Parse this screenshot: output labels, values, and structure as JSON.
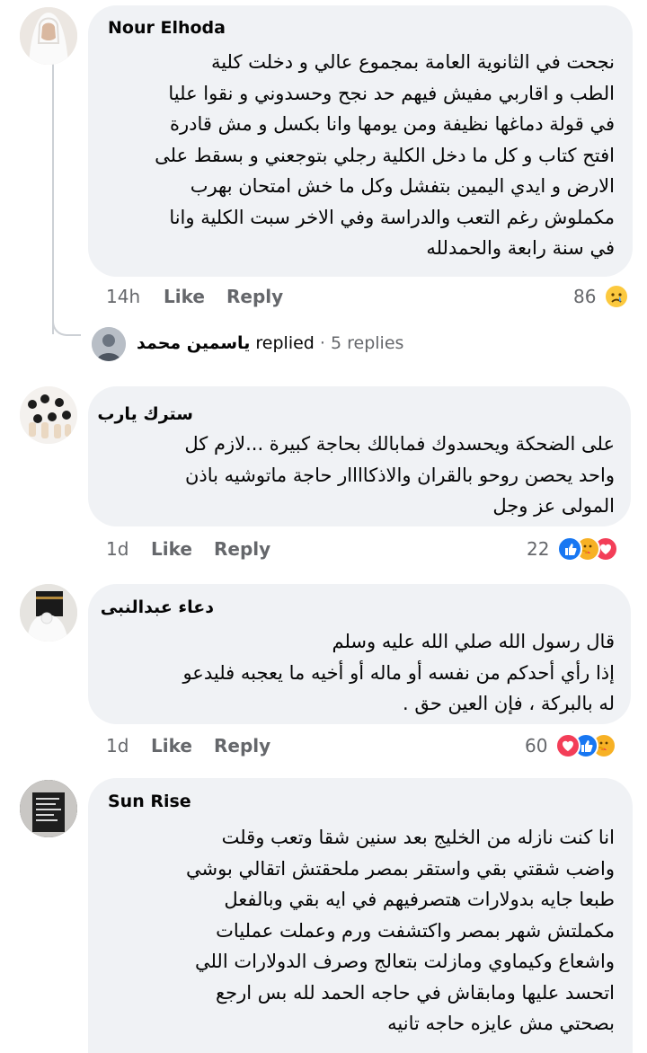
{
  "comments": [
    {
      "author": "Nour Elhoda",
      "text": "نجحت في الثانوية العامة بمجموع عالي و دخلت كلية\nالطب و اقاربي مفيش فيهم حد نجح وحسدوني و نقوا عليا\nفي قولة دماغها نظيفة ومن يومها وانا بكسل و مش قادرة\nافتح كتاب و كل ما دخل الكلية رجلي بتوجعني و بسقط على\nالارض و ايدي اليمين بتفشل وكل ما خش امتحان بهرب\nمكملوش رغم التعب والدراسة وفي الاخر سبت الكلية وانا\nفي سنة رابعة والحمدلله",
      "time": "14h",
      "like": "Like",
      "reply": "Reply",
      "count": "86",
      "reactions": [
        "sad"
      ]
    },
    {
      "author": "سترك يارب",
      "text": "على الضحكة ويحسدوك فمابالك بحاجة كبيرة ...لازم كل\nواحد يحصن روحو بالقران والاذكاااار حاجة ماتوشيه باذن\nالمولى عز وجل",
      "time": "1d",
      "like": "Like",
      "reply": "Reply",
      "count": "22",
      "reactions": [
        "like",
        "care",
        "love"
      ]
    },
    {
      "author": "دعاء عبدالنبى",
      "text": "قال رسول الله صلي الله عليه وسلم\nإذا رأي أحدكم من نفسه أو ماله أو أخيه ما يعجبه فليدعو\nله بالبركة ، فإن العين حق .",
      "time": "1d",
      "like": "Like",
      "reply": "Reply",
      "count": "60",
      "reactions": [
        "love",
        "like",
        "care"
      ]
    },
    {
      "author": "Sun Rise",
      "text": "انا كنت نازله من الخليج بعد سنين شقا وتعب وقلت\nواضب شقتي بقي واستقر بمصر ملحقتش اتقالي بوشي\nطبعا جايه بدولارات هتصرفيهم في ايه بقي وبالفعل\nمكملتش شهر بمصر واكتشفت ورم وعملت عمليات\nواشعاع وكيماوي ومازلت بتعالج وصرف الدولارات اللي\nاتحسد عليها ومابقاش في حاجه الحمد لله بس ارجع\nبصحتي مش عايزه حاجه تانيه"
    }
  ],
  "reply_summary": {
    "name": "ياسمين محمد",
    "action": "replied",
    "separator": "·",
    "count": "5 replies"
  },
  "colors": {
    "bubble": "#f0f2f5",
    "text": "#050505",
    "secondary": "#65676b",
    "like_blue": "#1877f2",
    "love_red": "#f33e58",
    "care_yellow": "#f7b125",
    "sad_yellow": "#fcc93e"
  }
}
